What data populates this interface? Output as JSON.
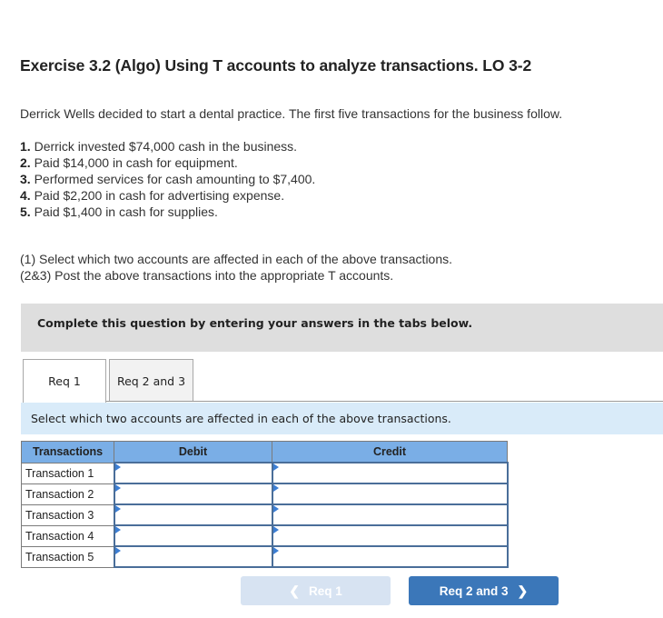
{
  "exercise": {
    "title": "Exercise 3.2 (Algo) Using T accounts to analyze transactions. LO 3-2",
    "intro": "Derrick Wells decided to start a dental practice. The first five transactions for the business follow.",
    "transactions": [
      {
        "num": "1.",
        "text": "Derrick invested $74,000 cash in the business."
      },
      {
        "num": "2.",
        "text": "Paid $14,000 in cash for equipment."
      },
      {
        "num": "3.",
        "text": "Performed services for cash amounting to $7,400."
      },
      {
        "num": "4.",
        "text": "Paid $2,200 in cash for advertising expense."
      },
      {
        "num": "5.",
        "text": "Paid $1,400 in cash for supplies."
      }
    ],
    "instructions": [
      "(1) Select which two accounts are affected in each of the above transactions.",
      "(2&3) Post the above transactions into the appropriate T accounts."
    ]
  },
  "banner": "Complete this question by entering your answers in the tabs below.",
  "tabs": [
    {
      "label": "Req 1",
      "active": true
    },
    {
      "label": "Req 2 and 3",
      "active": false
    }
  ],
  "tab_instruction": "Select which two accounts are affected in each of the above transactions.",
  "table": {
    "headers": [
      "Transactions",
      "Debit",
      "Credit"
    ],
    "rows": [
      {
        "label": "Transaction 1",
        "debit": "",
        "credit": ""
      },
      {
        "label": "Transaction 2",
        "debit": "",
        "credit": ""
      },
      {
        "label": "Transaction 3",
        "debit": "",
        "credit": ""
      },
      {
        "label": "Transaction 4",
        "debit": "",
        "credit": ""
      },
      {
        "label": "Transaction 5",
        "debit": "",
        "credit": ""
      }
    ]
  },
  "nav": {
    "prev_label": "Req 1",
    "next_label": "Req 2 and 3",
    "prev_icon": "chevron-left-icon",
    "next_icon": "chevron-right-icon",
    "prev_enabled": false,
    "next_enabled": true
  },
  "colors": {
    "header_bg": "#7aaee6",
    "banner_bg": "#dedede",
    "subband_bg": "#d9ebf9",
    "next_button": "#3b77b9",
    "prev_button_disabled": "#d7e3f2"
  }
}
